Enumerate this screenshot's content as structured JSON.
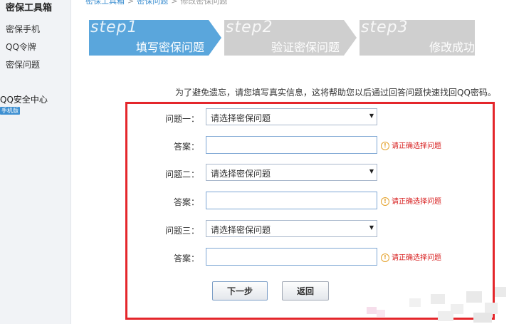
{
  "sidebar": {
    "title": "密保工具箱",
    "items": [
      {
        "label": "密保手机"
      },
      {
        "label": "QQ令牌"
      },
      {
        "label": "密保问题"
      }
    ],
    "security_center": "QQ安全中心",
    "badge": "手机版"
  },
  "breadcrumb": {
    "items": [
      "密保工具箱",
      "密保问题",
      "修改密保问题"
    ]
  },
  "steps": [
    {
      "word": "step1",
      "label": "填写密保问题",
      "active": true,
      "color": "#5aa6dc"
    },
    {
      "word": "step2",
      "label": "验证密保问题",
      "active": false,
      "color": "#cfcfcf"
    },
    {
      "word": "step3",
      "label": "修改成功",
      "active": false,
      "color": "#cfcfcf"
    }
  ],
  "intro": "为了避免遗忘，请您填写真实信息，这将帮助您以后通过回答问题快速找回QQ密码。",
  "form": {
    "questions": [
      {
        "label": "问题一：",
        "placeholder": "请选择密保问题",
        "answer_label": "答案：",
        "answer_value": "",
        "error": "请正确选择问题"
      },
      {
        "label": "问题二：",
        "placeholder": "请选择密保问题",
        "answer_label": "答案：",
        "answer_value": "",
        "error": "请正确选择问题"
      },
      {
        "label": "问题三：",
        "placeholder": "请选择密保问题",
        "answer_label": "答案：",
        "answer_value": "",
        "error": "请正确选择问题"
      }
    ],
    "next_label": "下一步",
    "back_label": "返回",
    "highlight_color": "#e4262b"
  },
  "icons": {
    "warning": "warning-icon",
    "dropdown": "chevron-down-icon"
  }
}
